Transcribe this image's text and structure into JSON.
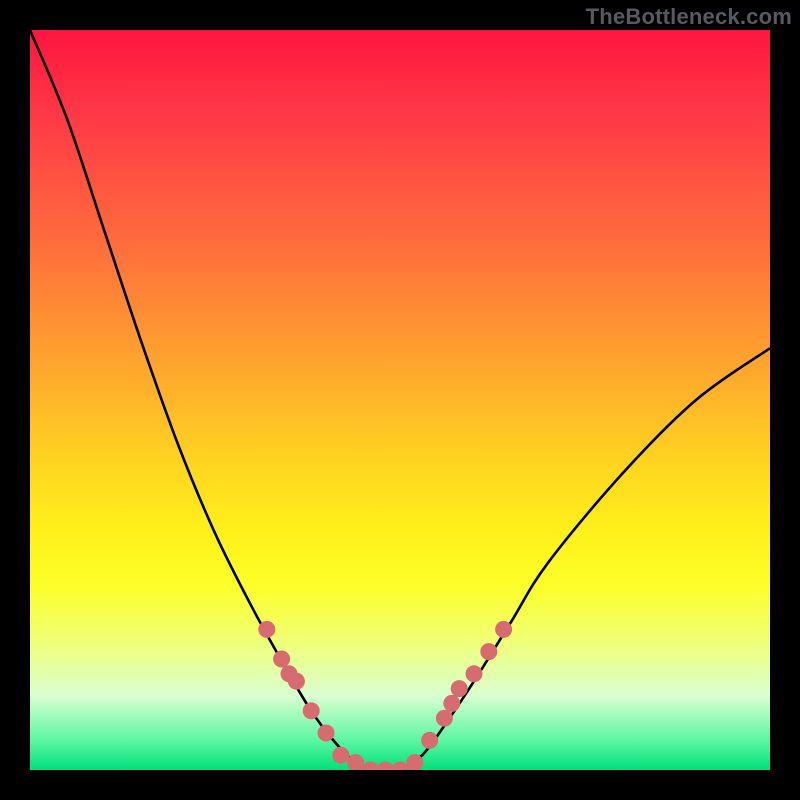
{
  "watermark": "TheBottleneck.com",
  "colors": {
    "frame": "#000000",
    "curve": "#000000",
    "marker": "#d66b70",
    "gradient_top": "#ff163f",
    "gradient_bottom": "#00e07a"
  },
  "chart_data": {
    "type": "line",
    "title": "",
    "xlabel": "",
    "ylabel": "",
    "xlim": [
      0,
      100
    ],
    "ylim": [
      0,
      100
    ],
    "grid": false,
    "legend": false,
    "series": [
      {
        "name": "bottleneck-curve",
        "x": [
          0,
          5,
          10,
          15,
          20,
          25,
          30,
          35,
          38,
          41,
          44,
          47,
          50,
          53,
          56,
          60,
          65,
          70,
          80,
          90,
          100
        ],
        "y": [
          100,
          88,
          73,
          58,
          44,
          32,
          22,
          13,
          8,
          4,
          1,
          0,
          0,
          2,
          6,
          12,
          20,
          28,
          40,
          50,
          57
        ]
      }
    ],
    "markers": {
      "name": "highlighted-points",
      "color": "#d66b70",
      "x": [
        32,
        34,
        35,
        36,
        38,
        40,
        42,
        44,
        46,
        48,
        50,
        52,
        54,
        56,
        57,
        58,
        60,
        62,
        64
      ],
      "y": [
        19,
        15,
        13,
        12,
        8,
        5,
        2,
        1,
        0,
        0,
        0,
        1,
        4,
        7,
        9,
        11,
        13,
        16,
        19
      ]
    }
  }
}
